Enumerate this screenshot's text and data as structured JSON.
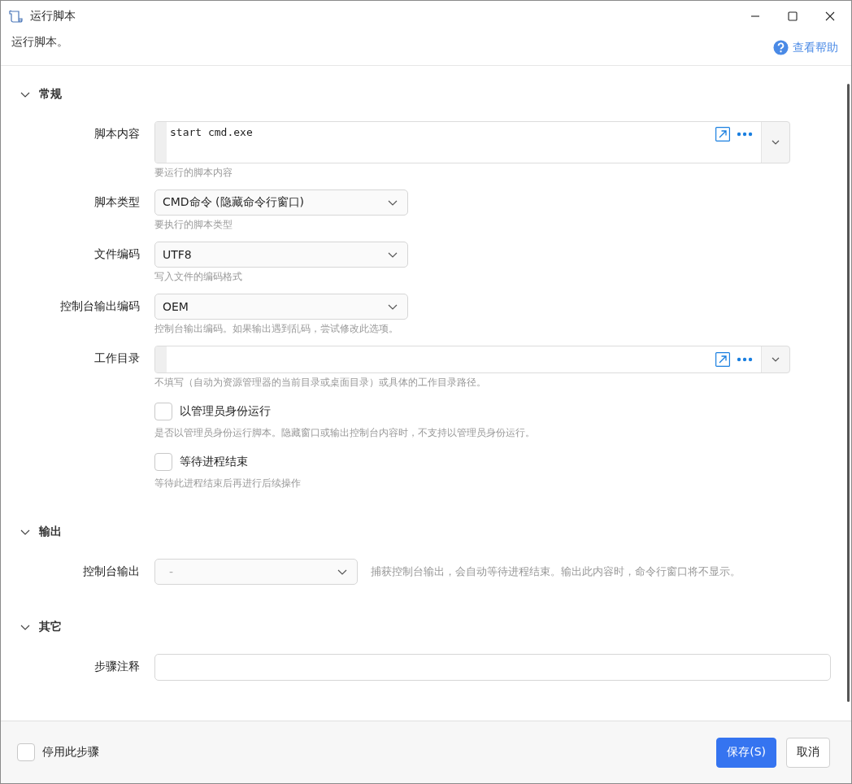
{
  "window": {
    "title": "运行脚本"
  },
  "description": "运行脚本。",
  "help_link": "查看帮助",
  "sections": [
    {
      "title": "常规",
      "expanded": true,
      "fields": [
        {
          "kind": "script",
          "label": "脚本内容",
          "value": "start cmd.exe",
          "hint": "要运行的脚本内容"
        },
        {
          "kind": "select",
          "label": "脚本类型",
          "value": "CMD命令 (隐藏命令行窗口)",
          "disabled": false,
          "hint": "要执行的脚本类型"
        },
        {
          "kind": "select",
          "label": "文件编码",
          "value": "UTF8",
          "disabled": false,
          "hint": "写入文件的编码格式"
        },
        {
          "kind": "select",
          "label": "控制台输出编码",
          "value": "OEM",
          "disabled": false,
          "hint": "控制台输出编码。如果输出遇到乱码，尝试修改此选项。"
        },
        {
          "kind": "path",
          "label": "工作目录",
          "hint": "不填写（自动为资源管理器的当前目录或桌面目录）或具体的工作目录路径。"
        },
        {
          "kind": "checkbox",
          "label": "以管理员身份运行",
          "checked": false,
          "hint": "是否以管理员身份运行脚本。隐藏窗口或输出控制台内容时，不支持以管理员身份运行。"
        },
        {
          "kind": "checkbox",
          "label": "等待进程结束",
          "checked": false,
          "hint": "等待此进程结束后再进行后续操作"
        }
      ]
    },
    {
      "title": "输出",
      "expanded": true,
      "fields": [
        {
          "kind": "select",
          "label": "控制台输出",
          "value": "-",
          "disabled": true,
          "side_hint": "捕获控制台输出，会自动等待进程结束。输出此内容时，命令行窗口将不显示。"
        }
      ]
    },
    {
      "title": "其它",
      "expanded": true,
      "fields": [
        {
          "kind": "text",
          "label": "步骤注释"
        }
      ]
    }
  ],
  "footer": {
    "disable_step": {
      "label": "停用此步骤",
      "checked": false
    },
    "buttons": [
      {
        "label": "保存(S)",
        "primary": true
      },
      {
        "label": "取消",
        "primary": false
      }
    ]
  }
}
